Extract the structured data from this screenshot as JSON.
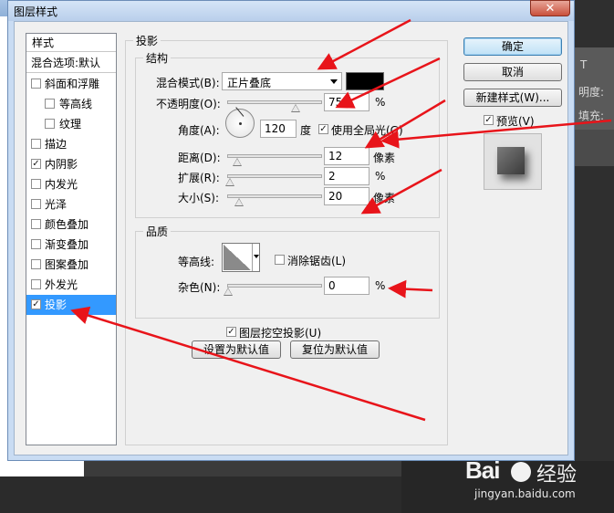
{
  "window": {
    "title": "图层样式",
    "close_glyph": "✕"
  },
  "style_list": {
    "header": "样式",
    "blend_options": "混合选项:默认",
    "items": [
      {
        "label": "斜面和浮雕",
        "checked": false,
        "indent": false
      },
      {
        "label": "等高线",
        "checked": false,
        "indent": true
      },
      {
        "label": "纹理",
        "checked": false,
        "indent": true
      },
      {
        "label": "描边",
        "checked": false,
        "indent": false
      },
      {
        "label": "内阴影",
        "checked": true,
        "indent": false
      },
      {
        "label": "内发光",
        "checked": false,
        "indent": false
      },
      {
        "label": "光泽",
        "checked": false,
        "indent": false
      },
      {
        "label": "颜色叠加",
        "checked": false,
        "indent": false
      },
      {
        "label": "渐变叠加",
        "checked": false,
        "indent": false
      },
      {
        "label": "图案叠加",
        "checked": false,
        "indent": false
      },
      {
        "label": "外发光",
        "checked": false,
        "indent": false
      },
      {
        "label": "投影",
        "checked": true,
        "indent": false,
        "selected": true
      }
    ]
  },
  "drop_shadow": {
    "title": "投影",
    "structure": {
      "title": "结构",
      "blend_mode_label": "混合模式(B):",
      "blend_mode_value": "正片叠底",
      "blend_color": "#000000",
      "opacity_label": "不透明度(O):",
      "opacity_value": "75",
      "opacity_unit": "%",
      "angle_label": "角度(A):",
      "angle_value": "120",
      "angle_unit": "度",
      "global_light_label": "使用全局光(G)",
      "global_light_checked": true,
      "distance_label": "距离(D):",
      "distance_value": "12",
      "distance_unit": "像素",
      "spread_label": "扩展(R):",
      "spread_value": "2",
      "spread_unit": "%",
      "size_label": "大小(S):",
      "size_value": "20",
      "size_unit": "像素"
    },
    "quality": {
      "title": "品质",
      "contour_label": "等高线:",
      "antialias_label": "消除锯齿(L)",
      "antialias_checked": false,
      "noise_label": "杂色(N):",
      "noise_value": "0",
      "noise_unit": "%"
    },
    "knockout_label": "图层挖空投影(U)",
    "knockout_checked": true,
    "set_default": "设置为默认值",
    "reset_default": "复位为默认值"
  },
  "buttons": {
    "ok": "确定",
    "cancel": "取消",
    "new_style": "新建样式(W)...",
    "preview_label": "预览(V)",
    "preview_checked": true
  },
  "background": {
    "right_text_1": "T",
    "right_text_2": "明度:",
    "right_text_3": "填充:"
  },
  "watermark": {
    "brand": "Bai",
    "brand_suffix": "经验",
    "url": "jingyan.baidu.com"
  },
  "colors": {
    "selection": "#3399ff",
    "annotation_arrow": "#e8141a",
    "dialog_frame": "#c9dcf3"
  }
}
